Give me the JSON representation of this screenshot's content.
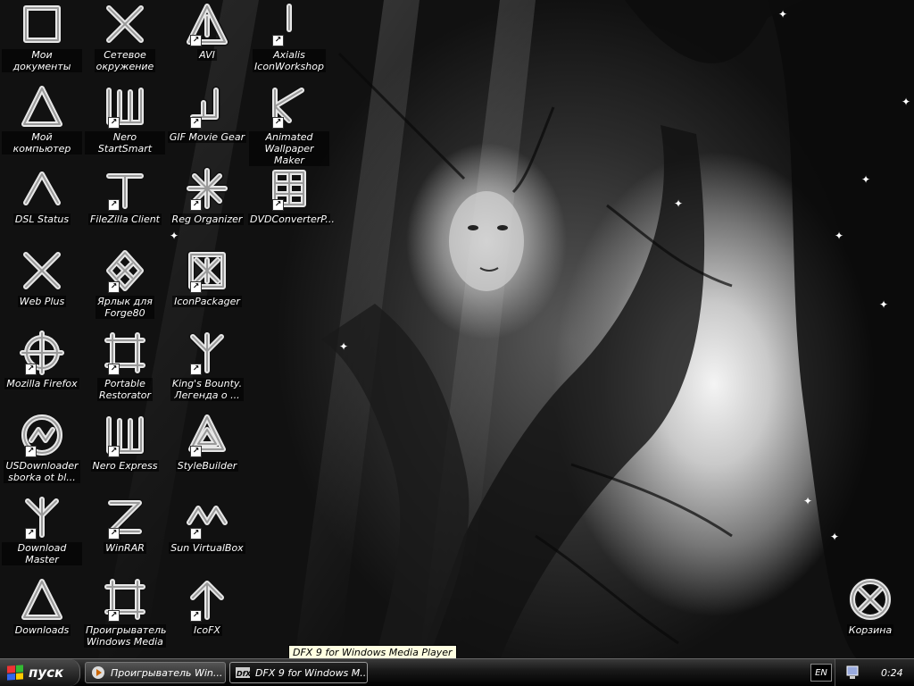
{
  "desktop": {
    "icons": [
      {
        "label": "Мои документы",
        "glyph": "square",
        "shortcut": false
      },
      {
        "label": "Мой компьютер",
        "glyph": "triangle",
        "shortcut": false
      },
      {
        "label": "DSL Status",
        "glyph": "caret",
        "shortcut": false
      },
      {
        "label": "Web Plus",
        "glyph": "x",
        "shortcut": false
      },
      {
        "label": "Mozilla Firefox",
        "glyph": "crosshair",
        "shortcut": true
      },
      {
        "label": "USDownloader\nsborka ot bl...",
        "glyph": "circle-zigzag",
        "shortcut": true
      },
      {
        "label": "Download Master",
        "glyph": "fork",
        "shortcut": true
      },
      {
        "label": "Downloads",
        "glyph": "triangle",
        "shortcut": false
      },
      {
        "label": "Сетевое\nокружение",
        "glyph": "x",
        "shortcut": false
      },
      {
        "label": "Nero StartSmart",
        "glyph": "shin",
        "shortcut": true
      },
      {
        "label": "FileZilla Client",
        "glyph": "tee",
        "shortcut": true
      },
      {
        "label": "Ярлык для\nForge80",
        "glyph": "knot",
        "shortcut": true
      },
      {
        "label": "Portable\nRestorator",
        "glyph": "frame",
        "shortcut": true
      },
      {
        "label": "Nero Express",
        "glyph": "shin",
        "shortcut": true
      },
      {
        "label": "WinRAR",
        "glyph": "zed",
        "shortcut": true
      },
      {
        "label": "Проигрыватель\nWindows Media",
        "glyph": "frame",
        "shortcut": true
      },
      {
        "label": "AVI",
        "glyph": "triangle-mark",
        "shortcut": true
      },
      {
        "label": "GIF Movie Gear",
        "glyph": "hook",
        "shortcut": true
      },
      {
        "label": "Reg Organizer",
        "glyph": "star",
        "shortcut": true
      },
      {
        "label": "IconPackager",
        "glyph": "box-star",
        "shortcut": true
      },
      {
        "label": "King's Bounty.\nЛегенда о ...",
        "glyph": "fork",
        "shortcut": true
      },
      {
        "label": "StyleBuilder",
        "glyph": "knot-tri",
        "shortcut": true
      },
      {
        "label": "Sun VirtualBox",
        "glyph": "wave",
        "shortcut": true
      },
      {
        "label": "IcoFX",
        "glyph": "arrow-up",
        "shortcut": true
      },
      {
        "label": "Axialis\nIconWorkshop",
        "glyph": "bar",
        "shortcut": true
      },
      {
        "label": "Animated\nWallpaper Maker",
        "glyph": "kink",
        "shortcut": true
      },
      {
        "label": "DVDConverterP...",
        "glyph": "grid",
        "shortcut": true
      }
    ],
    "recycle_bin": {
      "label": "Корзина",
      "glyph": "circle-x"
    }
  },
  "tooltip": {
    "text": "DFX 9 for Windows Media Player"
  },
  "taskbar": {
    "start_label": "пуск",
    "tasks": [
      {
        "label": "Проигрыватель Win...",
        "icon": "media-player-icon",
        "active": false
      },
      {
        "label": "DFX 9 for Windows M...",
        "icon": "dfx-icon",
        "active": true
      }
    ],
    "language": "EN",
    "clock": "0:24"
  }
}
